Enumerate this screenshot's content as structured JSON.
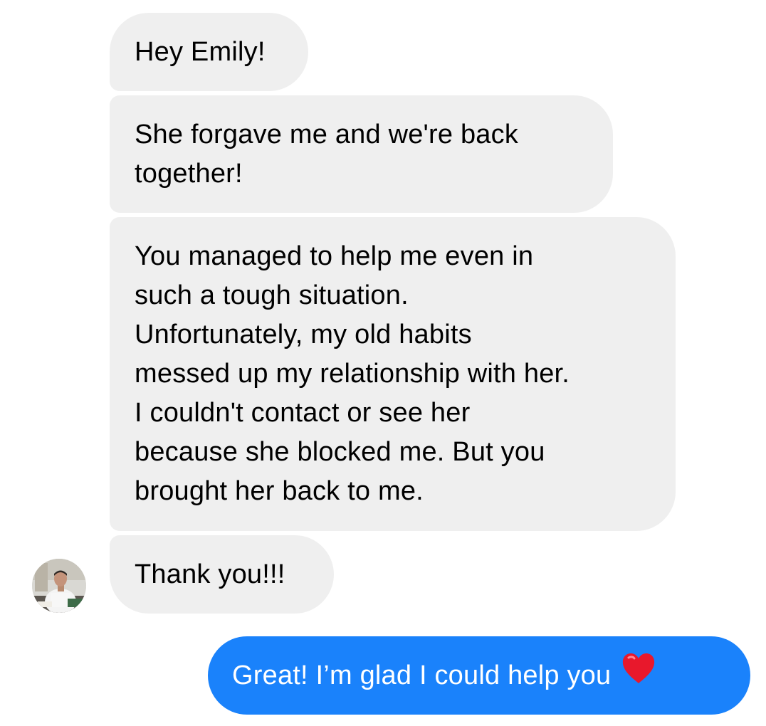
{
  "messages": [
    {
      "id": "m1",
      "direction": "incoming",
      "text": "Hey Emily!"
    },
    {
      "id": "m2",
      "direction": "incoming",
      "text": "She forgave me and we're back\ntogether!"
    },
    {
      "id": "m3",
      "direction": "incoming",
      "text": "You managed to help me even in\nsuch a tough situation.\nUnfortunately, my old habits\nmessed up my relationship with her.\nI couldn't contact or see her\nbecause she blocked me. But you\nbrought her back to me."
    },
    {
      "id": "m4",
      "direction": "incoming",
      "text": "Thank you!!!"
    },
    {
      "id": "m5",
      "direction": "outgoing",
      "text": "Great! I’m glad I could help you",
      "emoji": "red-heart-icon"
    }
  ],
  "avatar": {
    "icon": "sender-avatar"
  },
  "colors": {
    "incoming_bubble": "#efefef",
    "outgoing_bubble": "#1a82fb",
    "incoming_text": "#000000",
    "outgoing_text": "#ffffff",
    "heart": "#e8182c"
  }
}
